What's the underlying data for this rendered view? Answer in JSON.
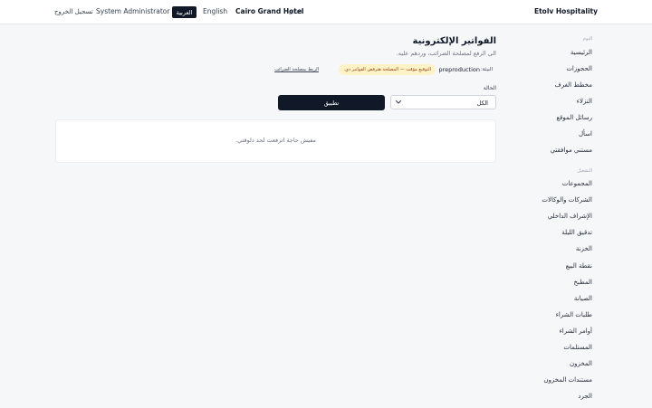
{
  "header": {
    "brand": "Etolv Hospitality",
    "hotel_label": "الفندق",
    "hotel_name": "Cairo Grand Hotel",
    "lang_en": "English",
    "lang_ar": "العربية",
    "user": "System Administrator",
    "logout": "تسجيل الخروج"
  },
  "sidebar": {
    "section_today": "اليوم",
    "today_items": [
      {
        "label": "الرئيسية"
      },
      {
        "label": "الحجوزات"
      },
      {
        "label": "مخطط الغرف"
      },
      {
        "label": "النزلاء"
      },
      {
        "label": "رسائل الموقع"
      },
      {
        "label": "اسأل"
      },
      {
        "label": "مستني موافقتي"
      }
    ],
    "section_ops": "التشغيل",
    "ops_items": [
      {
        "label": "المجموعات"
      },
      {
        "label": "الشركات والوكالات"
      },
      {
        "label": "الإشراف الداخلي"
      },
      {
        "label": "تدقيق الليلة"
      },
      {
        "label": "الخزنة"
      },
      {
        "label": "نقطة البيع"
      },
      {
        "label": "المطبخ"
      },
      {
        "label": "الصيانة"
      },
      {
        "label": "طلبات الشراء"
      },
      {
        "label": "أوامر الشراء"
      },
      {
        "label": "المستلمات"
      },
      {
        "label": "المخزون"
      },
      {
        "label": "مستندات المخزون"
      },
      {
        "label": "الجرد"
      }
    ]
  },
  "main": {
    "title": "الفواتير الإلكترونية",
    "subtitle": "الى الرفع لمصلحة الضرائب، وردهم عليه.",
    "env_label": "البيئة:",
    "env_value": "preproduction",
    "warning": "التوقيع مؤقت — المصلحة هترفض الفواتير دي.",
    "tax_link": "الربط بمصلحة الضرائب",
    "status_label": "الحالة",
    "status_value": "الكل",
    "apply": "تطبيق",
    "empty": "مفيش حاجة اترفعت لحد دلوقتي."
  },
  "colors": {
    "accent": "#111827",
    "warning_bg": "#fef3c7",
    "warning_text": "#92400e",
    "background": "#f6f7f9"
  }
}
